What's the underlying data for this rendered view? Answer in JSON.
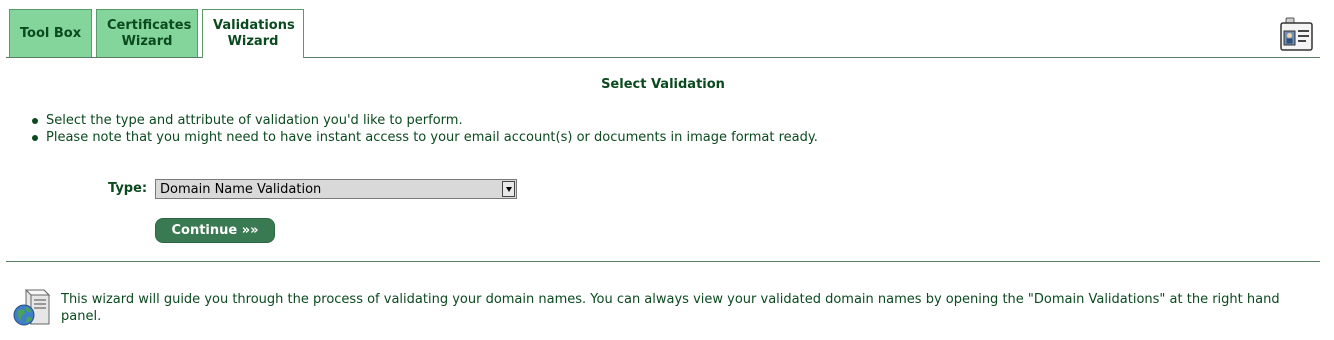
{
  "tabs": [
    {
      "label": "Tool Box"
    },
    {
      "label": "Certificates Wizard"
    },
    {
      "label": "Validations Wizard"
    }
  ],
  "header_icon": "id-card-icon",
  "main": {
    "title": "Select Validation",
    "bullets": [
      "Select the type and attribute of validation you'd like to perform.",
      "Please note that you might need to have instant access to your email account(s) or documents in image format ready."
    ],
    "type_label": "Type:",
    "type_selected": "Domain Name Validation",
    "continue_label": "Continue »»"
  },
  "footer": {
    "icon": "server-globe-icon",
    "text": "This wizard will guide you through the process of validating your domain names. You can always view your validated domain names by opening the \"Domain Validations\" at the right hand panel."
  },
  "colors": {
    "text": "#0b4a1f",
    "tab_inactive": "#84d59c",
    "button": "#3a7a52"
  }
}
